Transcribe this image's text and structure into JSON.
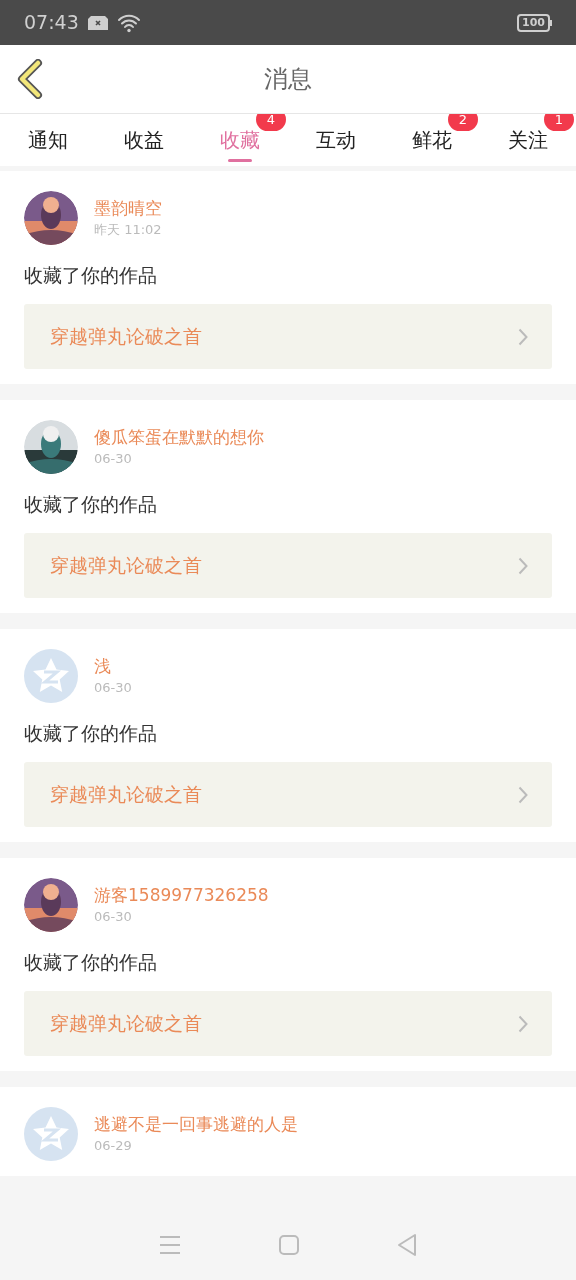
{
  "status_bar": {
    "time": "07:43",
    "battery": "100"
  },
  "header": {
    "title": "消息"
  },
  "tabs": [
    {
      "label": "通知",
      "selected": false
    },
    {
      "label": "收益",
      "selected": false
    },
    {
      "label": "收藏",
      "selected": true,
      "badge": "4"
    },
    {
      "label": "互动",
      "selected": false
    },
    {
      "label": "鲜花",
      "selected": false,
      "badge": "2"
    },
    {
      "label": "关注",
      "selected": false,
      "badge": "1"
    }
  ],
  "messages": [
    {
      "name": "墨韵晴空",
      "time": "昨天 11:02",
      "text": "收藏了你的作品",
      "work": "穿越弹丸论破之首"
    },
    {
      "name": "傻瓜笨蛋在默默的想你",
      "time": "06-30",
      "text": "收藏了你的作品",
      "work": "穿越弹丸论破之首"
    },
    {
      "avatar": {
        "kind": "default"
      },
      "name": "浅",
      "time": "06-30",
      "text": "收藏了你的作品",
      "work": "穿越弹丸论破之首"
    },
    {
      "name": "游客1589977326258",
      "time": "06-30",
      "text": "收藏了你的作品",
      "work": "穿越弹丸论破之首"
    },
    {
      "avatar": {
        "kind": "default"
      },
      "name": "逃避不是一回事逃避的人是",
      "time": "06-29"
    }
  ]
}
